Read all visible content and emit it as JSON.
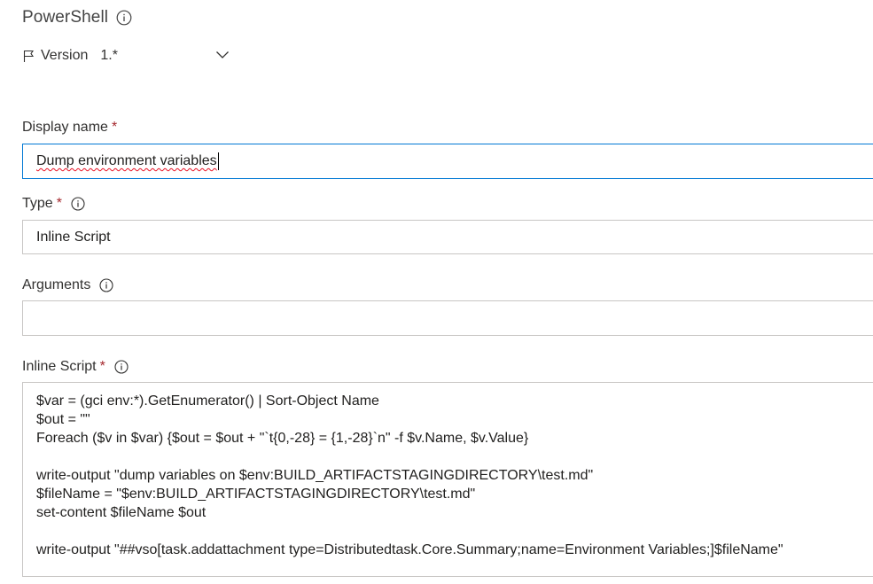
{
  "task": {
    "title": "PowerShell"
  },
  "version": {
    "label": "Version",
    "value": "1.*"
  },
  "fields": {
    "display_name": {
      "label": "Display name",
      "required": "*",
      "value": "Dump environment variables"
    },
    "type": {
      "label": "Type",
      "required": "*",
      "value": "Inline Script"
    },
    "arguments": {
      "label": "Arguments",
      "value": ""
    },
    "inline_script": {
      "label": "Inline Script",
      "required": "*",
      "lines": [
        "$var = (gci env:*).GetEnumerator() | Sort-Object Name",
        "$out = \"\"",
        "Foreach ($v in $var) {$out = $out + \"`t{0,-28} = {1,-28}`n\" -f $v.Name, $v.Value}",
        "",
        "write-output \"dump variables on $env:BUILD_ARTIFACTSTAGINGDIRECTORY\\test.md\"",
        "$fileName = \"$env:BUILD_ARTIFACTSTAGINGDIRECTORY\\test.md\"",
        "set-content $fileName $out",
        "",
        "write-output \"##vso[task.addattachment type=Distributedtask.Core.Summary;name=Environment Variables;]$fileName\""
      ]
    }
  },
  "icons": {
    "info": "info-icon",
    "flag": "flag-icon",
    "chevron": "chevron-down-icon"
  },
  "colors": {
    "required_asterisk": "#a4262c",
    "focus_border": "#0078d4",
    "field_border": "#c8c6c4",
    "spellcheck": "#e81123"
  }
}
